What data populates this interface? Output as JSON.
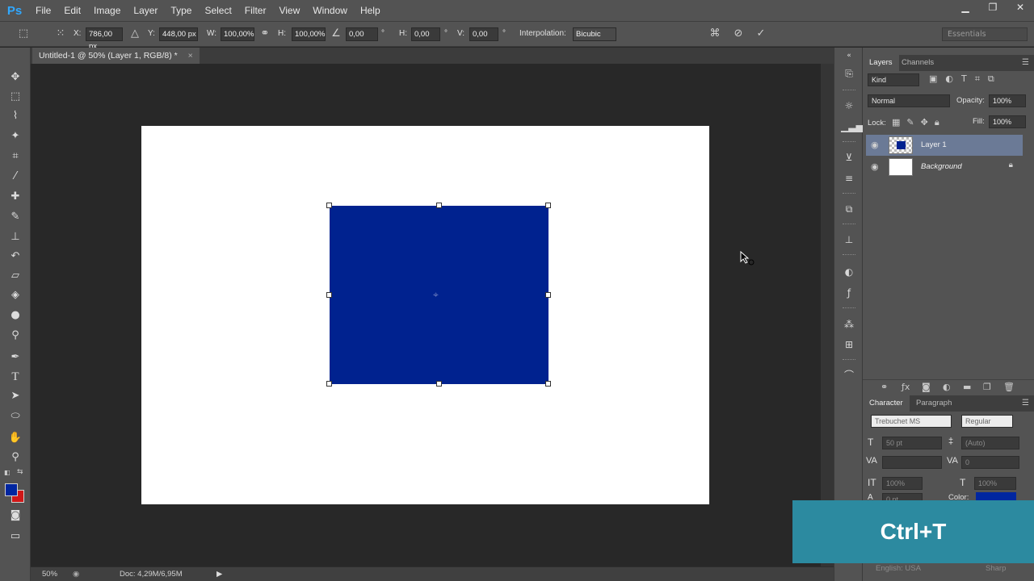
{
  "app": {
    "logo": "Ps"
  },
  "menu": [
    "File",
    "Edit",
    "Image",
    "Layer",
    "Type",
    "Select",
    "Filter",
    "View",
    "Window",
    "Help"
  ],
  "window_controls": {
    "minimize": "▁",
    "restore": "❐",
    "close": "✕"
  },
  "options": {
    "x_label": "X:",
    "x_value": "786,00 px",
    "y_label": "Y:",
    "y_value": "448,00 px",
    "w_label": "W:",
    "w_value": "100,00%",
    "h_label": "H:",
    "h_value": "100,00%",
    "angle_value": "0,00",
    "angle_unit": "°",
    "hskew_label": "H:",
    "hskew_value": "0,00",
    "hskew_unit": "°",
    "vskew_label": "V:",
    "vskew_value": "0,00",
    "vskew_unit": "°",
    "interpolation_label": "Interpolation:",
    "interpolation_value": "Bicubic",
    "workspace": "Essentials"
  },
  "document": {
    "tab_title": "Untitled-1 @ 50% (Layer 1, RGB/8) *",
    "tab_close": "×",
    "canvas_color": "#ffffff",
    "shape_color": "#00228f"
  },
  "status": {
    "zoom": "50%",
    "doc_info": "Doc: 4,29M/6,95M"
  },
  "colors": {
    "foreground": "#0026a0",
    "background": "#d01818"
  },
  "layers_panel": {
    "tabs": [
      "Layers",
      "Channels"
    ],
    "filter_kind": "Kind",
    "blend_mode": "Normal",
    "opacity_label": "Opacity:",
    "opacity_value": "100%",
    "lock_label": "Lock:",
    "fill_label": "Fill:",
    "fill_value": "100%",
    "layers": [
      {
        "name": "Layer 1",
        "selected": true
      },
      {
        "name": "Background",
        "selected": false
      }
    ]
  },
  "character_panel": {
    "tabs": [
      "Character",
      "Paragraph"
    ],
    "font_family": "Trebuchet MS",
    "font_style": "Regular",
    "font_size": "50 pt",
    "leading": "(Auto)",
    "tracking": "0",
    "vscale": "100%",
    "hscale": "100%",
    "baseline": "0 pt",
    "color_label": "Color:",
    "language": "English: USA",
    "antialias": "Sharp"
  },
  "overlay": {
    "shortcut": "Ctrl+T"
  }
}
